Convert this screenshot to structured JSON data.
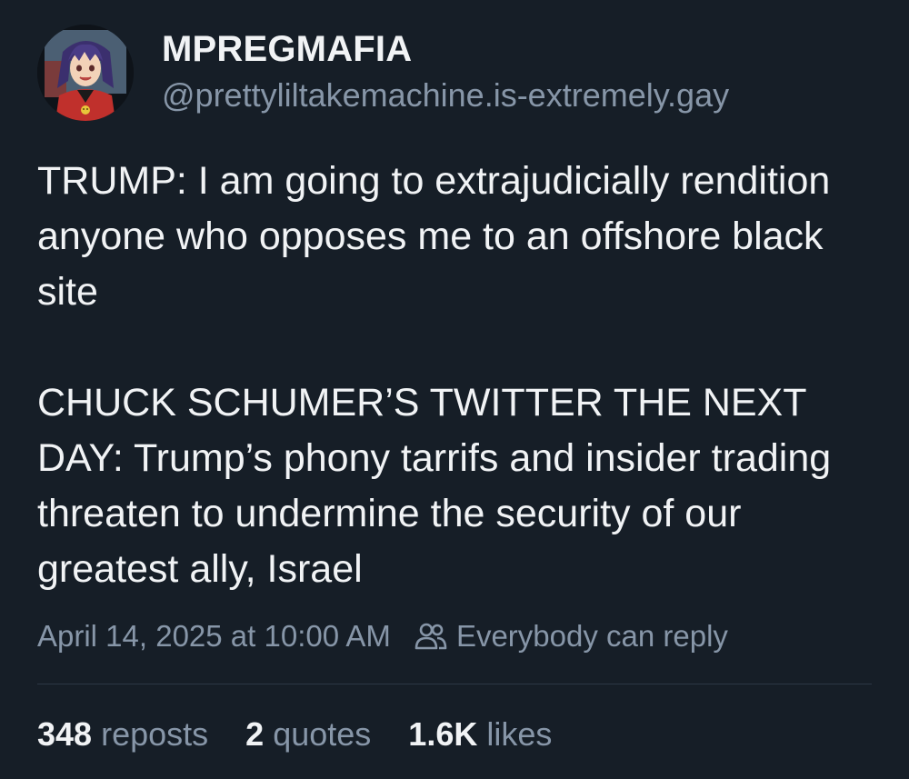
{
  "author": {
    "display_name": "MPREGMAFIA",
    "handle": "@prettyliltakemachine.is-extremely.gay"
  },
  "post": {
    "paragraphs": [
      "TRUMP: I am going to extrajudicially rendition anyone who opposes me to an offshore black site",
      "CHUCK SCHUMER’S TWITTER THE NEXT DAY: Trump’s phony tarrifs and insider trading threaten to undermine the security of our greatest ally, Israel"
    ],
    "timestamp": "April 14, 2025 at 10:00 AM",
    "reply_setting": "Everybody can reply"
  },
  "stats": {
    "reposts": {
      "count": "348",
      "label": "reposts"
    },
    "quotes": {
      "count": "2",
      "label": "quotes"
    },
    "likes": {
      "count": "1.6K",
      "label": "likes"
    }
  },
  "colors": {
    "background": "#161e27",
    "text_primary": "#f1f3f5",
    "text_secondary": "#8796a8"
  },
  "icons": {
    "avatar": "anime-character-avatar",
    "reply_setting": "people-icon"
  }
}
